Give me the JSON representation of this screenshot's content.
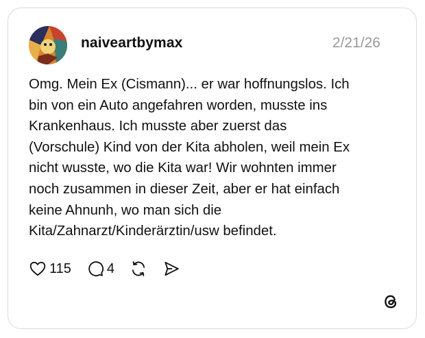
{
  "post": {
    "username": "naiveartbymax",
    "date": "2/21/26",
    "text_lines": [
      "Omg. Mein Ex (Cismann)... er war hoffnungslos. Ich",
      "bin von ein Auto angefahren worden, musste ins",
      "Krankenhaus. Ich musste aber zuerst das",
      "(Vorschule) Kind von der Kita abholen, weil mein Ex",
      "nicht wusste, wo die Kita war! Wir wohnten immer",
      "noch zusammen in dieser Zeit, aber er hat einfach",
      "keine Ahnunh, wo man sich die",
      "Kita/Zahnarzt/Kinderärztin/usw befindet."
    ]
  },
  "actions": {
    "like_count": "115",
    "reply_count": "4",
    "icons": [
      "heart-icon",
      "reply-icon",
      "repost-icon",
      "share-icon"
    ]
  },
  "branding": {
    "logo": "threads-logo-icon"
  },
  "colors": {
    "text": "#101010",
    "muted": "#999999",
    "border": "#d9d9d9"
  }
}
